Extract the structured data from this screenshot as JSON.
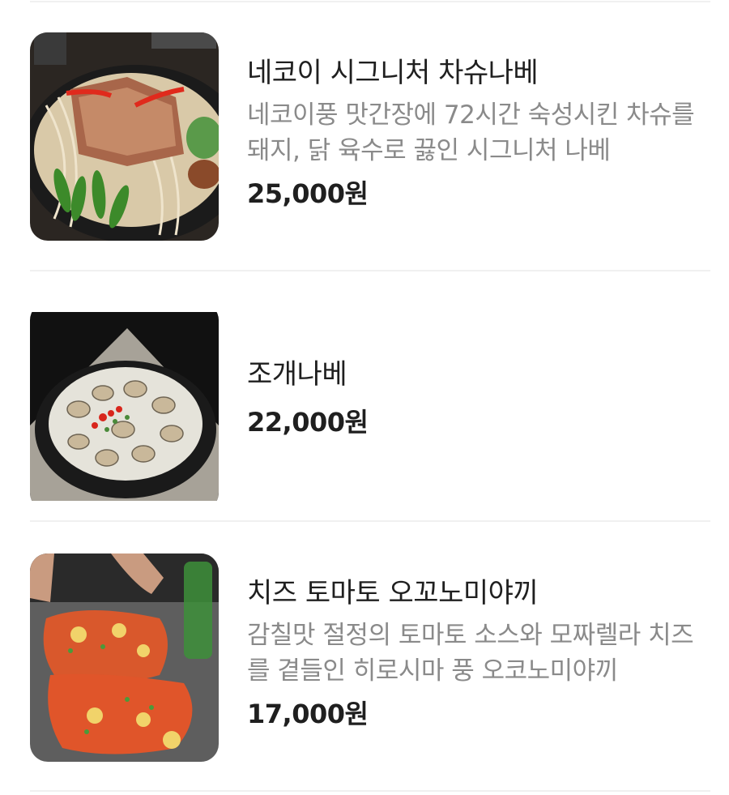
{
  "menu": {
    "items": [
      {
        "name": "네코이 시그니처 차슈나베",
        "description": "네코이풍 맛간장에 72시간 숙성시킨 차슈를 돼지, 닭 육수로 끓인 시그니처 나베",
        "price": "25,000원",
        "image_icon": "food-photo-chashu-nabe"
      },
      {
        "name": "조개나베",
        "description": "",
        "price": "22,000원",
        "image_icon": "food-photo-clam-nabe"
      },
      {
        "name": "치즈 토마토 오꼬노미야끼",
        "description": "감칠맛 절정의 토마토 소스와 모짜렐라 치즈를 곁들인 히로시마 풍 오코노미야끼",
        "price": "17,000원",
        "image_icon": "food-photo-okonomiyaki"
      }
    ]
  }
}
